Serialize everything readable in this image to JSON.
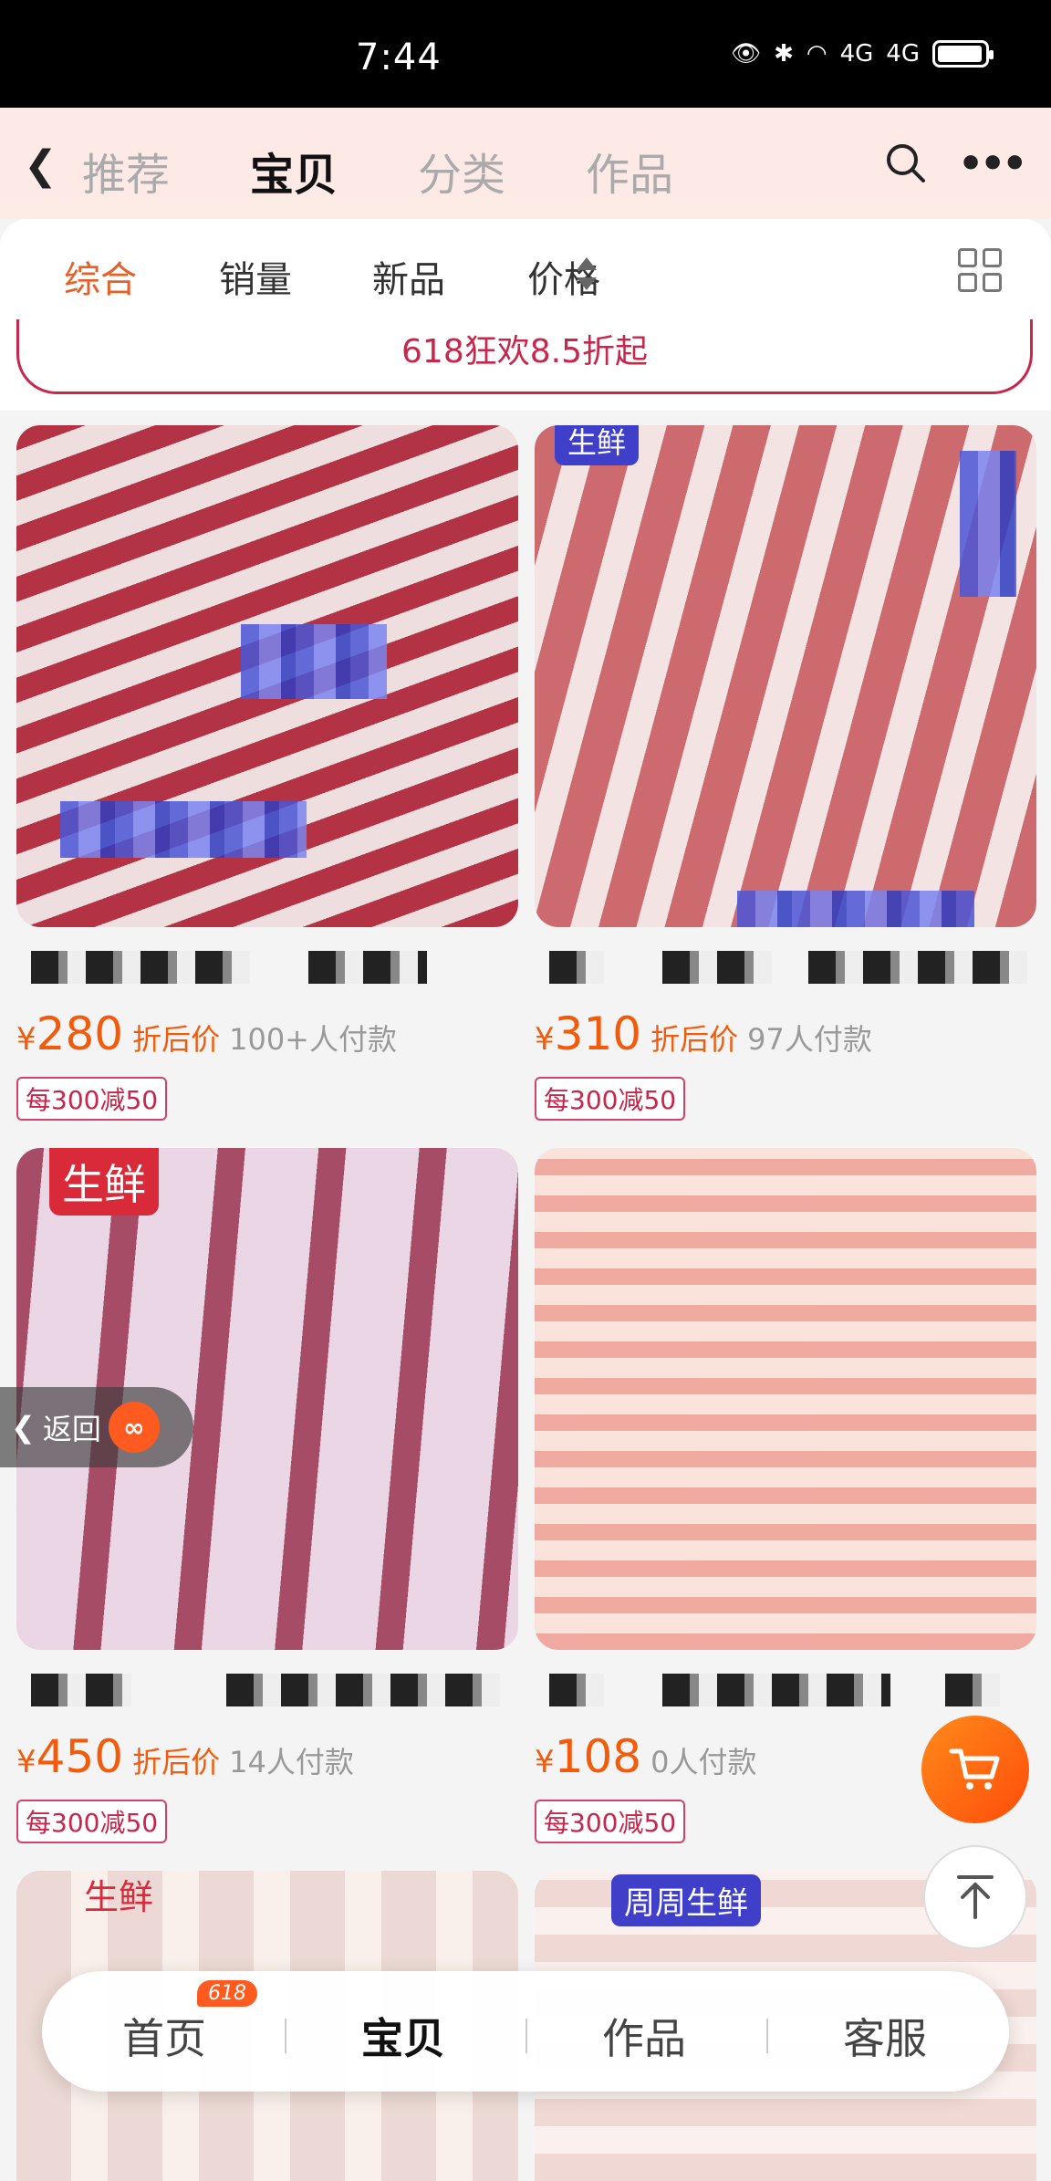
{
  "status_bar": {
    "time": "7:44",
    "network_1": "4G",
    "network_2": "4G"
  },
  "top_nav": {
    "tabs": [
      {
        "label": "推荐"
      },
      {
        "label": "宝贝"
      },
      {
        "label": "分类"
      },
      {
        "label": "作品"
      }
    ],
    "active_tab": "宝贝"
  },
  "filters": {
    "items": [
      {
        "label": "综合"
      },
      {
        "label": "销量"
      },
      {
        "label": "新品"
      },
      {
        "label": "价格"
      }
    ],
    "active": "综合"
  },
  "promo_banner": {
    "text": "618狂欢8.5折起"
  },
  "products": [
    {
      "currency": "¥",
      "price": "280",
      "price_label": "折后价",
      "sold": "100+人付款",
      "coupon": "每300减50"
    },
    {
      "currency": "¥",
      "price": "310",
      "price_label": "折后价",
      "sold": "97人付款",
      "coupon": "每300减50",
      "tag": "生鲜"
    },
    {
      "currency": "¥",
      "price": "450",
      "price_label": "折后价",
      "sold": "14人付款",
      "coupon": "每300减50",
      "tag": "生鲜"
    },
    {
      "currency": "¥",
      "price": "108",
      "sold": "0人付款",
      "coupon": "每300减50"
    },
    {
      "tag": "生鲜"
    },
    {
      "tag": "周周生鲜"
    }
  ],
  "return_button": {
    "label": "返回"
  },
  "bottom_nav": {
    "items": [
      {
        "label": "首页",
        "badge": "618"
      },
      {
        "label": "宝贝"
      },
      {
        "label": "作品"
      },
      {
        "label": "客服"
      }
    ],
    "active": "宝贝"
  },
  "colors": {
    "accent": "#f25b0b",
    "filter_active": "#e4622a",
    "promo": "#c8264a",
    "tag_red": "#d92a3a",
    "tag_blue": "#3f3fc9"
  }
}
